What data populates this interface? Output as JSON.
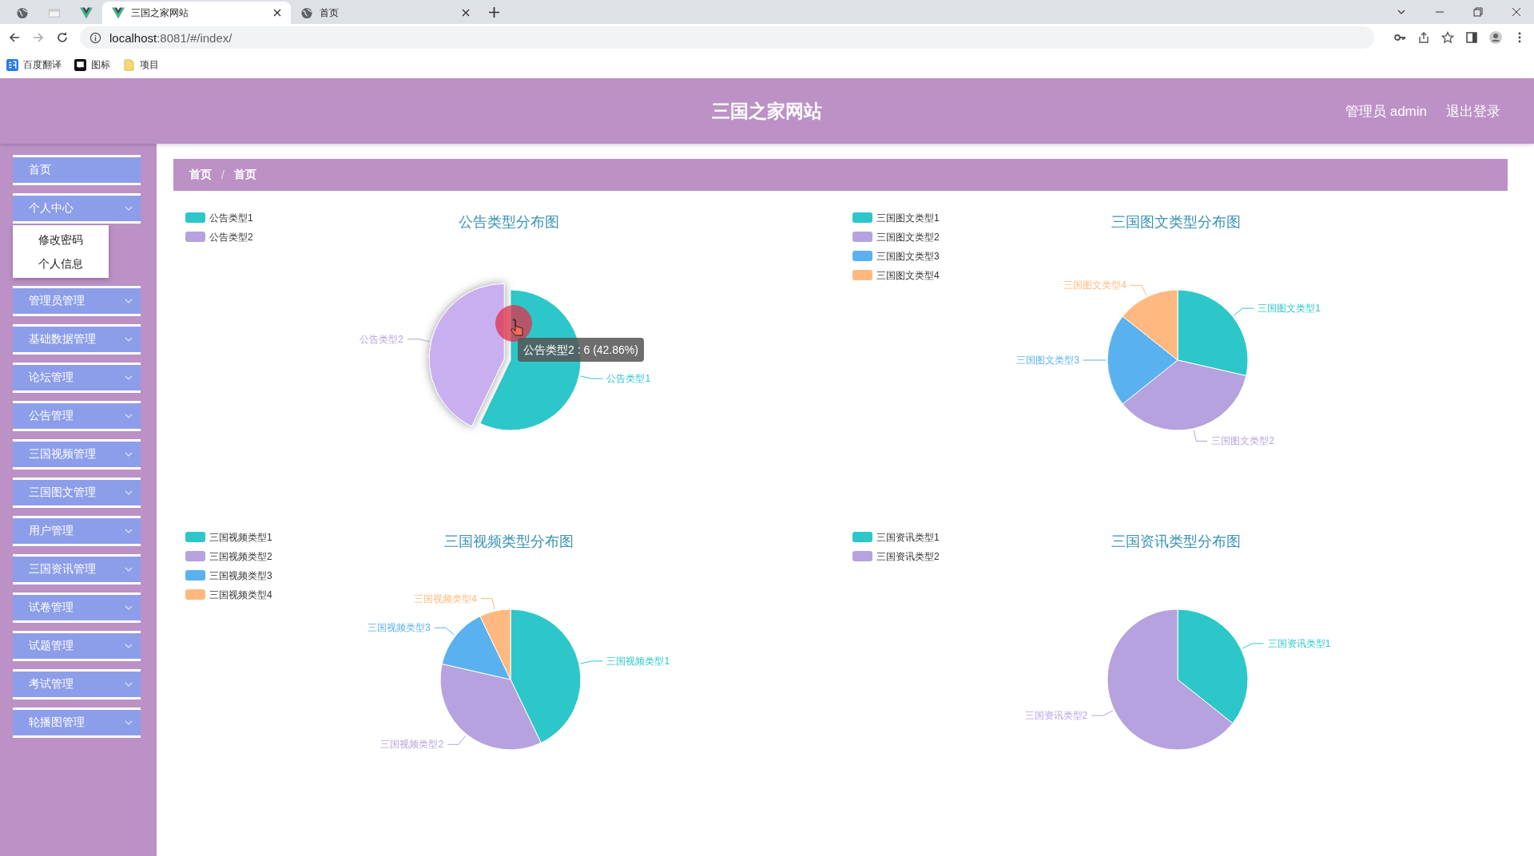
{
  "browser": {
    "tabs": [
      {
        "kind": "globe",
        "selected": false
      },
      {
        "kind": "page",
        "selected": false
      },
      {
        "kind": "vue",
        "selected": false
      },
      {
        "kind": "vue",
        "title": "三国之家网站",
        "selected": true
      },
      {
        "kind": "globe",
        "title": "首页",
        "selected": false
      }
    ],
    "address": {
      "host": "localhost",
      "path": ":8081/#/index/"
    },
    "bookmarks": [
      {
        "kind": "translate",
        "label": "百度翻译"
      },
      {
        "kind": "flag",
        "label": "图标"
      },
      {
        "kind": "folder",
        "label": "项目"
      }
    ]
  },
  "header": {
    "title": "三国之家网站",
    "user": "管理员 admin",
    "logout": "退出登录"
  },
  "sidebar": {
    "items": [
      {
        "label": "首页",
        "kind": "link"
      },
      {
        "label": "个人中心",
        "kind": "submenu",
        "children": [
          {
            "label": "修改密码"
          },
          {
            "label": "个人信息"
          }
        ]
      },
      {
        "label": "管理员管理",
        "kind": "submenu"
      },
      {
        "label": "基础数据管理",
        "kind": "submenu"
      },
      {
        "label": "论坛管理",
        "kind": "submenu"
      },
      {
        "label": "公告管理",
        "kind": "submenu"
      },
      {
        "label": "三国视频管理",
        "kind": "submenu"
      },
      {
        "label": "三国图文管理",
        "kind": "submenu"
      },
      {
        "label": "用户管理",
        "kind": "submenu"
      },
      {
        "label": "三国资讯管理",
        "kind": "submenu"
      },
      {
        "label": "试卷管理",
        "kind": "submenu"
      },
      {
        "label": "试题管理",
        "kind": "submenu"
      },
      {
        "label": "考试管理",
        "kind": "submenu"
      },
      {
        "label": "轮播图管理",
        "kind": "submenu"
      }
    ]
  },
  "breadcrumb": {
    "items": [
      "首页",
      "首页"
    ],
    "separator": "/"
  },
  "charts": [
    {
      "legend": [
        {
          "label": "公告类型1",
          "color": "#2ec7c9",
          "hovered": false
        },
        {
          "label": "公告类型2",
          "color": "#b6a2de",
          "hovered": true
        }
      ],
      "chart_data": {
        "type": "pie",
        "title": "公告类型分布图",
        "categories": [
          "公告类型1",
          "公告类型2"
        ],
        "values": [
          57.14,
          42.86
        ]
      },
      "tooltip": "公告类型2 : 6 (42.86%)"
    },
    {
      "legend": [
        {
          "label": "三国图文类型1",
          "color": "#2ec7c9"
        },
        {
          "label": "三国图文类型2",
          "color": "#b6a2de"
        },
        {
          "label": "三国图文类型3",
          "color": "#5ab1ef"
        },
        {
          "label": "三国图文类型4",
          "color": "#ffb980"
        }
      ],
      "chart_data": {
        "type": "pie",
        "title": "三国图文类型分布图",
        "categories": [
          "三国图文类型1",
          "三国图文类型2",
          "三国图文类型3",
          "三国图文类型4"
        ],
        "values": [
          28.57,
          35.71,
          21.43,
          14.29
        ]
      }
    },
    {
      "legend": [
        {
          "label": "三国视频类型1",
          "color": "#2ec7c9"
        },
        {
          "label": "三国视频类型2",
          "color": "#b6a2de"
        },
        {
          "label": "三国视频类型3",
          "color": "#5ab1ef"
        },
        {
          "label": "三国视频类型4",
          "color": "#ffb980"
        }
      ],
      "chart_data": {
        "type": "pie",
        "title": "三国视频类型分布图",
        "categories": [
          "三国视频类型1",
          "三国视频类型2",
          "三国视频类型3",
          "三国视频类型4"
        ],
        "values": [
          42.86,
          35.71,
          14.29,
          7.14
        ]
      }
    },
    {
      "legend": [
        {
          "label": "三国资讯类型1",
          "color": "#2ec7c9"
        },
        {
          "label": "三国资讯类型2",
          "color": "#b6a2de"
        }
      ],
      "chart_data": {
        "type": "pie",
        "title": "三国资讯类型分布图",
        "categories": [
          "三国资讯类型1",
          "三国资讯类型2"
        ],
        "values": [
          35.71,
          64.29
        ]
      }
    }
  ]
}
